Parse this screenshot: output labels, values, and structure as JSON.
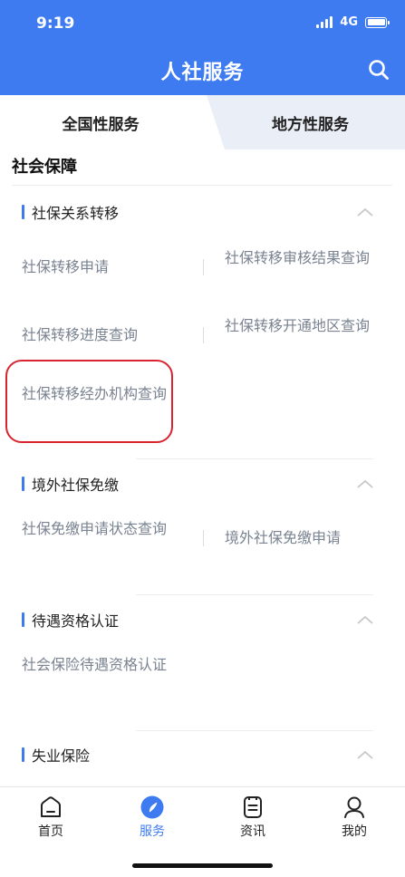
{
  "status_bar": {
    "time": "9:19",
    "network": "4G"
  },
  "header": {
    "title": "人社服务"
  },
  "tabs": [
    {
      "label": "全国性服务",
      "active": true
    },
    {
      "label": "地方性服务",
      "active": false
    }
  ],
  "section": {
    "title": "社会保障"
  },
  "categories": [
    {
      "title": "社保关系转移",
      "items": [
        {
          "label": "社保转移申请"
        },
        {
          "label": "社保转移审核结果查询"
        },
        {
          "label": "社保转移进度查询"
        },
        {
          "label": "社保转移开通地区查询"
        },
        {
          "label": "社保转移经办机构查询"
        }
      ]
    },
    {
      "title": "境外社保免缴",
      "items": [
        {
          "label": "社保免缴申请状态查询"
        },
        {
          "label": "境外社保免缴申请"
        }
      ]
    },
    {
      "title": "待遇资格认证",
      "items": [
        {
          "label": "社会保险待遇资格认证"
        }
      ]
    },
    {
      "title": "失业保险",
      "items": []
    }
  ],
  "bottom_nav": [
    {
      "label": "首页",
      "icon": "home-icon",
      "active": false
    },
    {
      "label": "服务",
      "icon": "compass-icon",
      "active": true
    },
    {
      "label": "资讯",
      "icon": "news-icon",
      "active": false
    },
    {
      "label": "我的",
      "icon": "profile-icon",
      "active": false
    }
  ],
  "colors": {
    "primary": "#3e7bf0",
    "highlight": "#d9232f"
  }
}
